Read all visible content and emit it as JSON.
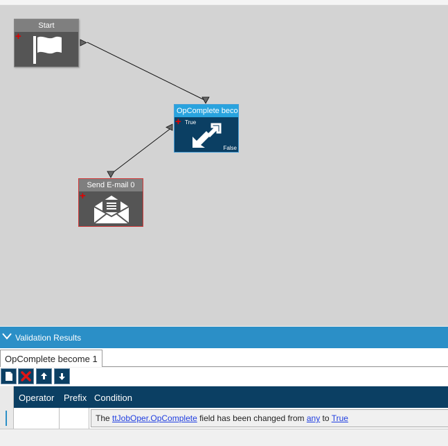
{
  "top_partial_text": "",
  "nodes": {
    "start": {
      "title": "Start",
      "icon": "flag-icon"
    },
    "decision": {
      "title": "OpComplete becor",
      "true_label": "True",
      "false_label": "False",
      "icon": "arrows-diagonal-icon"
    },
    "email": {
      "title": "Send E-mail 0",
      "icon": "envelope-icon"
    }
  },
  "validation": {
    "header_title": "Validation Results",
    "tab_label": "OpComplete become 1"
  },
  "grid": {
    "columns": [
      "Operator",
      "Prefix",
      "Condition"
    ],
    "row": {
      "operator": "",
      "prefix": "",
      "condition": {
        "part1": "The ",
        "field_link": "ttJobOper.OpComplete",
        "part2": " field has been changed from ",
        "from_link": "any",
        "part3": " to ",
        "to_link": "True"
      }
    }
  },
  "colors": {
    "canvas_bg": "#d3d3d3",
    "node_dark": "#555555",
    "node_title_gray": "#7f7f7f",
    "decision_bg": "#0b3f63",
    "decision_title": "#29a3de",
    "panel_header": "#2b8fc7",
    "grid_header": "#0b3f63",
    "plus_red": "#e00000",
    "link_blue": "#1f3ee0"
  }
}
